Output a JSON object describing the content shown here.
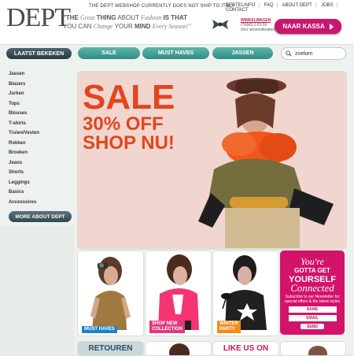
{
  "brand": {
    "logo": "DEPT",
    "notice": "THE DEPT WEBSHOP CURRENTLY DOES NOT SHIP TO ITALY"
  },
  "top_links": [
    "BESTELINFO",
    "FAQ",
    "ABOUT DEPT",
    "JOBS",
    "CONTACT"
  ],
  "quote": {
    "line1_a": "\"THE",
    "line1_b": "Great",
    "line1_c": "THING",
    "line1_d": "ABOUT",
    "line1_e": "Fashion",
    "line1_f": "IS THAT",
    "line2_a": "YOU CAN",
    "line2_b": "Change",
    "line2_c": "YOUR",
    "line2_d": "MIND",
    "line2_e": "Every Season!\""
  },
  "cart": {
    "title": "WINKELWAGEN",
    "items": "ITEMS 0   €0.00",
    "shipping": "(incl verzendkosten)",
    "button": "NAAR KASSA"
  },
  "nav": {
    "main": "LAATST BEKEKEN",
    "tabs": [
      "SALE",
      "MUST HAVES",
      "JASSEN"
    ],
    "search_value": "zoeken"
  },
  "sidebar": {
    "items": [
      "Jassen",
      "Blazers",
      "Jurken",
      "Tops",
      "Blouses",
      "T-shirts",
      "Truien/Vesten",
      "Rokken",
      "Broeken",
      "Jeans",
      "Shorts",
      "Leggings",
      "Basics",
      "Accessoires"
    ],
    "more": "MORE ABOUT DEPT"
  },
  "hero": {
    "line1": "SALE",
    "line2": "30% OFF",
    "line3": "SHOP NU!"
  },
  "tiles": [
    {
      "label": "MUST HAVES"
    },
    {
      "label_line1": "SHOP NEW",
      "label_line2": "COLLECTION"
    },
    {
      "label_line1": "WINTER",
      "label_line2": "PARTY"
    }
  ],
  "newsletter": {
    "line1": "You're",
    "line2": "GOTTA GET",
    "line3": "YOURSELF",
    "line4": "Connected",
    "line5": "Subscribe to our Newsletter for special offers & the latest styles",
    "name": "NAME",
    "email": "EMAIL",
    "send": "SEND"
  },
  "bottom": {
    "left": "RETOUREN",
    "right": "LIKE US ON"
  },
  "colors": {
    "accent_pink": "#d3136a",
    "sale_orange": "#e3451d",
    "teal": "#3e9b90"
  }
}
